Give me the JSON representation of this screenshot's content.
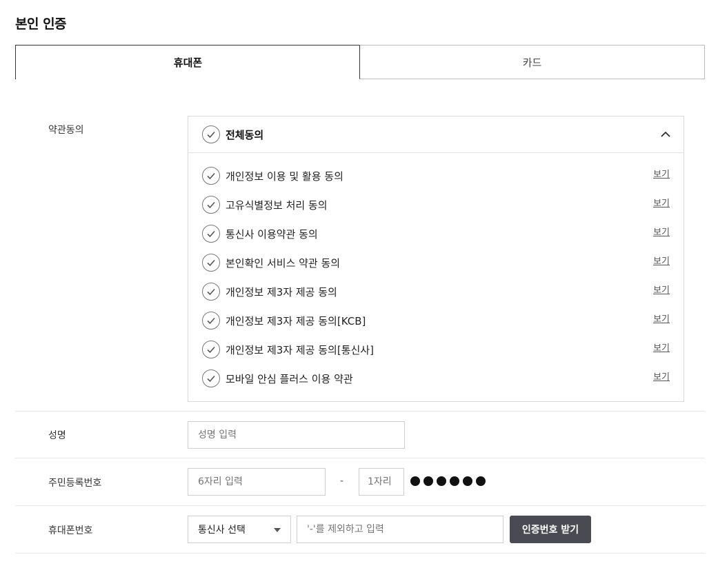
{
  "page": {
    "title": "본인 인증"
  },
  "tabs": [
    {
      "label": "휴대폰",
      "active": true
    },
    {
      "label": "카드",
      "active": false
    }
  ],
  "terms": {
    "row_label": "약관동의",
    "all_label": "전체동의",
    "view_label": "보기",
    "items": [
      {
        "label": "개인정보 이용 및 활용 동의"
      },
      {
        "label": "고유식별정보 처리 동의"
      },
      {
        "label": "통신사 이용약관 동의"
      },
      {
        "label": "본인확인 서비스 약관 동의"
      },
      {
        "label": "개인정보 제3자 제공 동의"
      },
      {
        "label": "개인정보 제3자 제공 동의[KCB]"
      },
      {
        "label": "개인정보 제3자 제공 동의[통신사]"
      },
      {
        "label": "모바일 안심 플러스 이용 약관"
      }
    ]
  },
  "name_row": {
    "label": "성명",
    "placeholder": "성명 입력"
  },
  "rrn_row": {
    "label": "주민등록번호",
    "front_placeholder": "6자리 입력",
    "separator": "-",
    "back_placeholder": "1자리",
    "masked_digits": 6
  },
  "phone_row": {
    "label": "휴대폰번호",
    "carrier_selected": "통신사 선택",
    "number_placeholder": "'-'를 제외하고 입력",
    "request_button": "인증번호 받기"
  },
  "colors": {
    "button_bg": "#4a4a52",
    "border": "#cfcfcf",
    "text": "#222222"
  },
  "icons": {
    "check": "check-circle-icon",
    "collapse": "chevron-up-icon",
    "dropdown": "caret-down-icon"
  }
}
